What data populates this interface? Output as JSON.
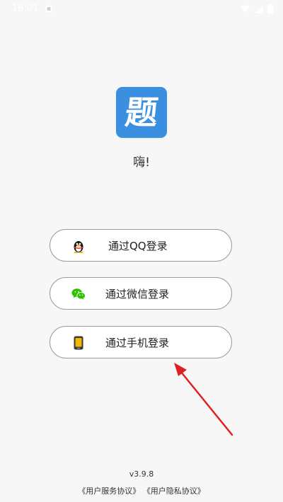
{
  "status_bar": {
    "time": "16:01",
    "notification_icon": "notification-square-icon",
    "wifi_icon": "wifi-icon",
    "signal_icon": "signal-icon",
    "battery_icon": "battery-icon"
  },
  "app": {
    "logo_glyph": "题",
    "logo_color": "#3b8fe0",
    "greeting": "嗨!"
  },
  "login": {
    "qq_label": "通过QQ登录",
    "qq_icon": "qq-penguin-icon",
    "wechat_label": "通过微信登录",
    "wechat_icon": "wechat-icon",
    "phone_label": "通过手机登录",
    "phone_icon": "phone-icon"
  },
  "annotation": {
    "arrow_color": "#e02020"
  },
  "footer": {
    "version": "v3.9.8",
    "user_service_agreement": "《用户服务协议》",
    "user_privacy_agreement": "《用户隐私协议》"
  }
}
